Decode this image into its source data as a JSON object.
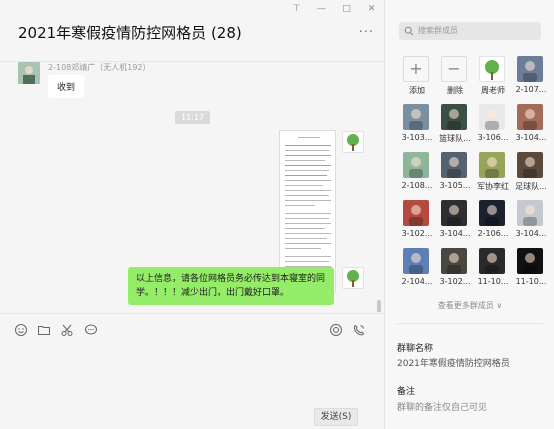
{
  "window_controls": {
    "pin": "⊤",
    "minimize": "—",
    "maximize": "□",
    "close": "✕"
  },
  "chat": {
    "title": "2021年寒假疫情防控网格员 (28)",
    "more": "···",
    "sender_name": "2-108邓靖广（无人机192）",
    "received_text": "收到",
    "time": "11:17",
    "outgoing_text": "以上信息，请各位网格员务必传达到本寝室的同学。！！！减少出门，出门戴好口罩。",
    "send_label": "发送(S)"
  },
  "toolbar": {
    "icons": [
      "emoji-icon",
      "folder-icon",
      "scissors-icon",
      "chat-bubble-icon",
      "voice-call-icon",
      "video-call-icon"
    ]
  },
  "side": {
    "search_placeholder": "搜索群成员",
    "members": [
      {
        "name": "添加",
        "kind": "add"
      },
      {
        "name": "删除",
        "kind": "remove"
      },
      {
        "name": "周老师",
        "color": "#ffffff"
      },
      {
        "name": "2-107...",
        "color": "#6b7d99"
      },
      {
        "name": "3-103...",
        "color": "#7a8fa0"
      },
      {
        "name": "篮球队...",
        "color": "#3b4f45"
      },
      {
        "name": "3-106...",
        "color": "#e8e8e8"
      },
      {
        "name": "3-104...",
        "color": "#a36b5a"
      },
      {
        "name": "2-108...",
        "color": "#8fb59a"
      },
      {
        "name": "3-105...",
        "color": "#556270"
      },
      {
        "name": "军协李红",
        "color": "#9aa35a"
      },
      {
        "name": "足球队...",
        "color": "#5b4a3c"
      },
      {
        "name": "3-102...",
        "color": "#b34a3f"
      },
      {
        "name": "3-104...",
        "color": "#2f2f33"
      },
      {
        "name": "2-106...",
        "color": "#1c2130"
      },
      {
        "name": "3-104...",
        "color": "#c4c8cf"
      },
      {
        "name": "2-104...",
        "color": "#5e7fb5"
      },
      {
        "name": "3-102...",
        "color": "#4a4640"
      },
      {
        "name": "11-10...",
        "color": "#2a2a2a"
      },
      {
        "name": "11-10...",
        "color": "#111111"
      }
    ],
    "see_more": "查看更多群成员 ∨",
    "group_name_label": "群聊名称",
    "group_name": "2021年寒假疫情防控网格员",
    "remark_label": "备注",
    "remark_value": "群聊的备注仅自己可见"
  }
}
